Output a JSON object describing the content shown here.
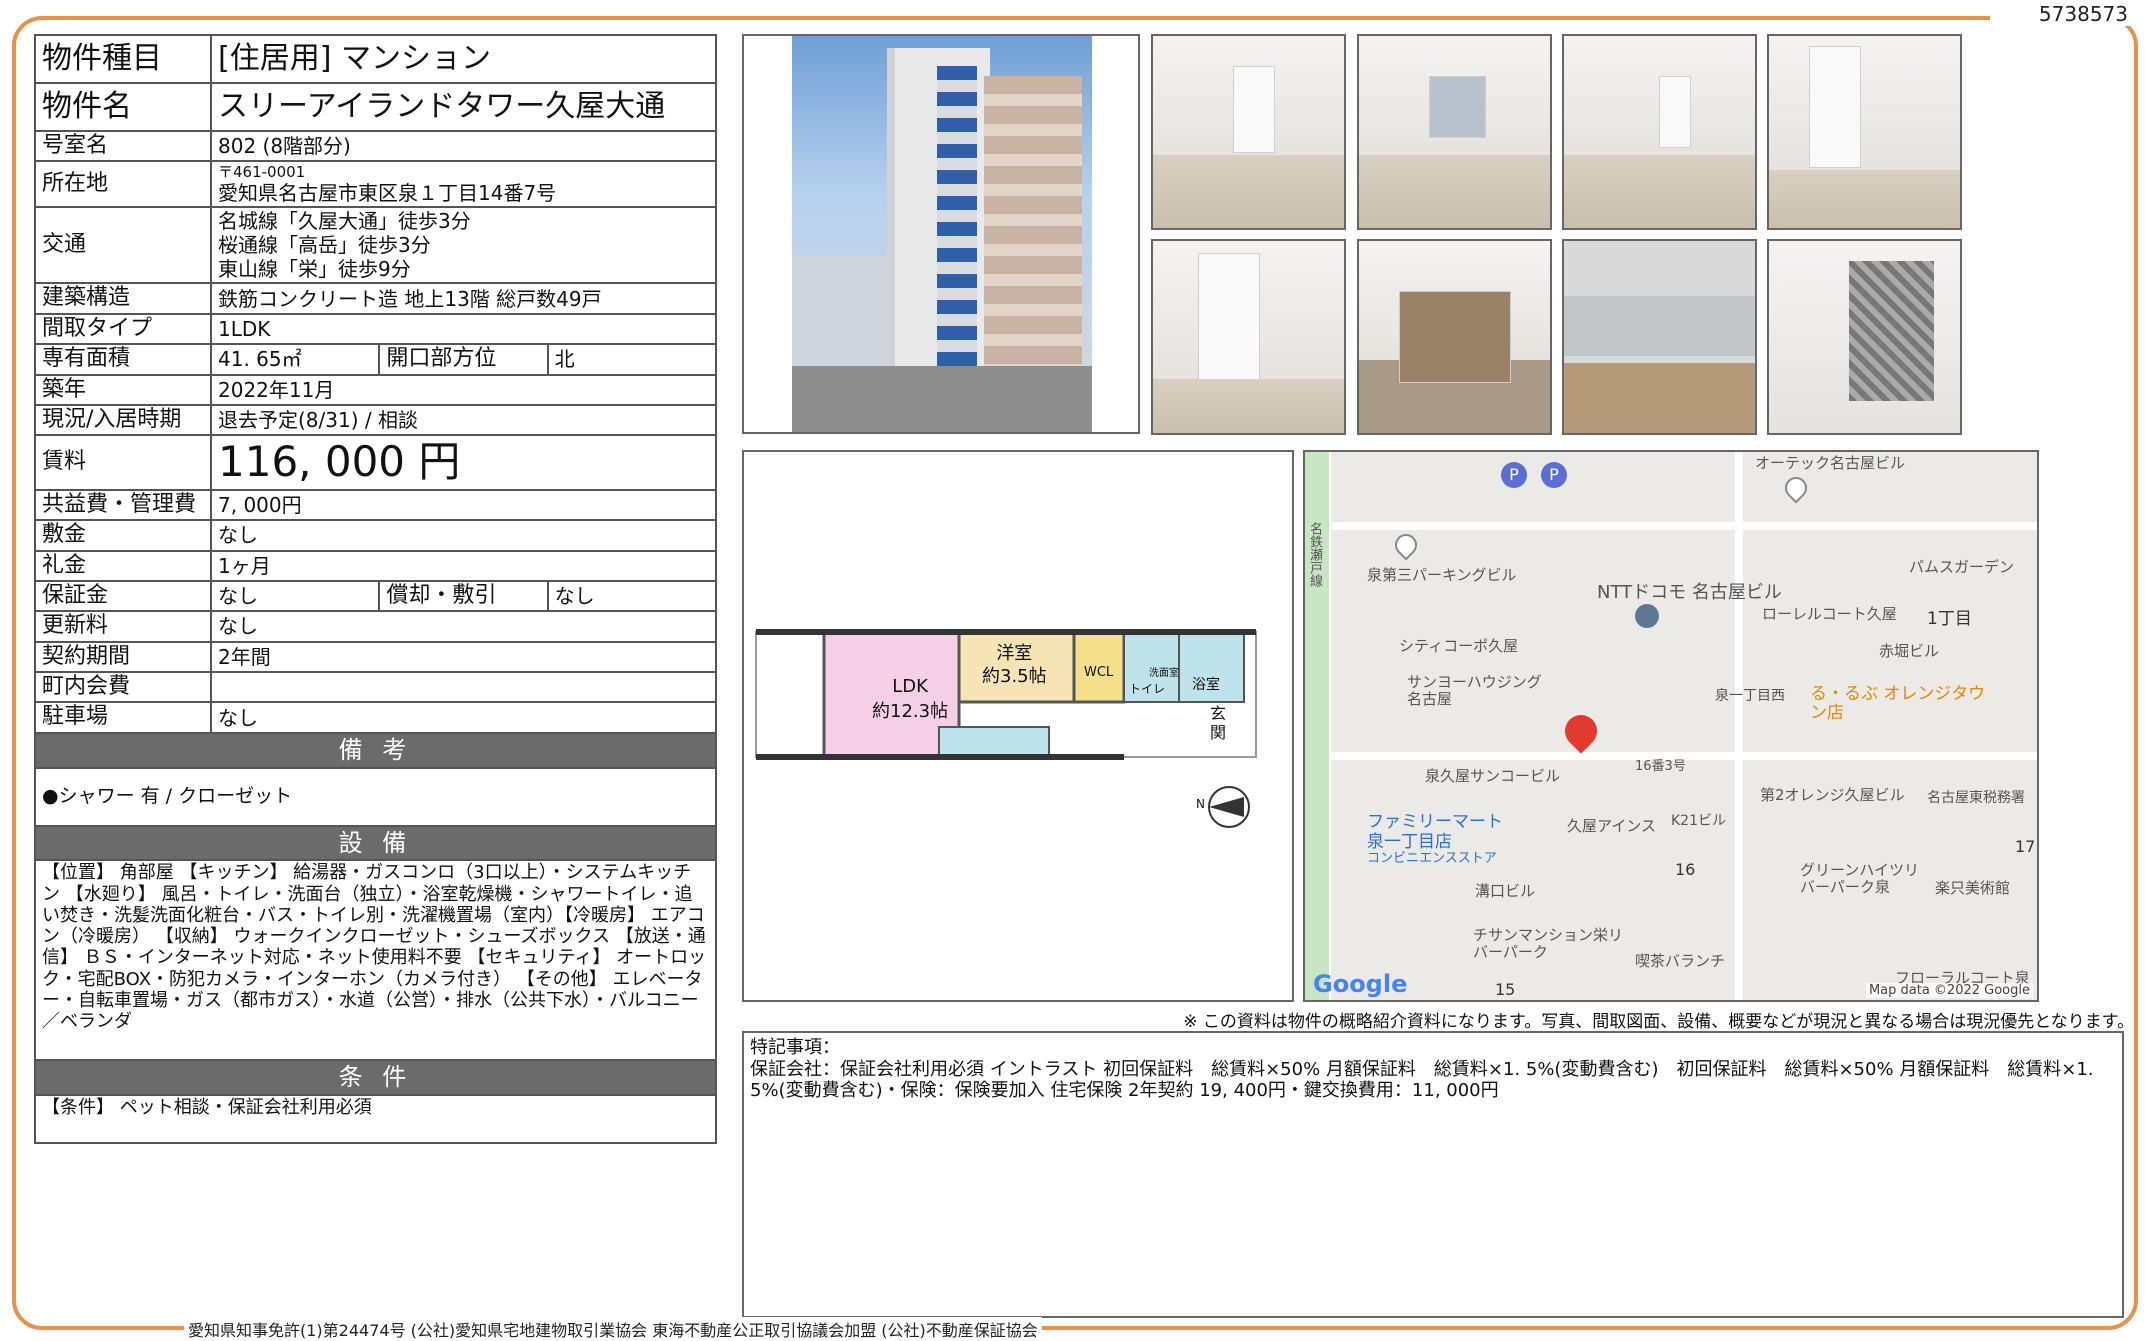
{
  "doc_id": "5738573",
  "property": {
    "rows": [
      {
        "key": "物件種目",
        "value": "[住居用] マンション"
      },
      {
        "key": "物件名",
        "value": "スリーアイランドタワー久屋大通"
      },
      {
        "key": "号室名",
        "value": "802 (8階部分)"
      },
      {
        "key": "所在地",
        "postal": "〒461-0001",
        "value": "愛知県名古屋市東区泉１丁目14番7号"
      },
      {
        "key": "交通",
        "lines": [
          "名城線「久屋大通」徒歩3分",
          "桜通線「高岳」徒歩3分",
          "東山線「栄」徒歩9分"
        ]
      },
      {
        "key": "建築構造",
        "value": "鉄筋コンクリート造 地上13階 総戸数49戸"
      },
      {
        "key": "間取タイプ",
        "value": "1LDK"
      },
      {
        "key": "専有面積",
        "value": "41. 65㎡",
        "key2": "開口部方位",
        "value2": "北"
      },
      {
        "key": "築年",
        "value": "2022年11月"
      },
      {
        "key": "現況/入居時期",
        "value": "退去予定(8/31)  /  相談"
      },
      {
        "key": "賃料",
        "value": "116, 000 円"
      },
      {
        "key": "共益費・管理費",
        "value": "7, 000円"
      },
      {
        "key": "敷金",
        "value": "なし"
      },
      {
        "key": "礼金",
        "value": "1ヶ月"
      },
      {
        "key": "保証金",
        "value": "なし",
        "key2": "償却・敷引",
        "value2": "なし"
      },
      {
        "key": "更新料",
        "value": "なし"
      },
      {
        "key": "契約期間",
        "value": "2年間"
      },
      {
        "key": "町内会費",
        "value": ""
      },
      {
        "key": "駐車場",
        "value": "なし"
      }
    ],
    "bikou_title": "備 考",
    "bikou_text": "●シャワー 有 / クローゼット",
    "setsubi_title": "設 備",
    "setsubi_text": "【位置】 角部屋 【キッチン】 給湯器・ガスコンロ（3口以上）・システムキッチン 【水廻り】 風呂・トイレ・洗面台（独立）・浴室乾燥機・シャワートイレ・追い焚き・洗髪洗面化粧台・バス・トイレ別・洗濯機置場（室内）【冷暖房】 エアコン（冷暖房） 【収納】 ウォークインクローゼット・シューズボックス 【放送・通信】 ＢＳ・インターネット対応・ネット使用料不要 【セキュリティ】 オートロック・宅配BOX・防犯カメラ・インターホン（カメラ付き） 【その他】 エレベーター・自転車置場・ガス（都市ガス）・水道（公営）・排水（公共下水）・バルコニー／ベランダ",
    "jouken_title": "条 件",
    "jouken_text": "【条件】 ペット相談・保証会社利用必須"
  },
  "floorplan": {
    "ldk": "LDK",
    "ldk_size": "約12.3帖",
    "youshitsu": "洋室",
    "youshitsu_size": "約3.5帖",
    "wcl": "WCL",
    "toilet": "トイレ",
    "senmen": "洗面室",
    "bath": "浴室",
    "genkan1": "玄",
    "genkan2": "関",
    "north": "N"
  },
  "map": {
    "labels": [
      "オーテック名古屋ビル",
      "泉第三パーキングビル",
      "NTTドコモ 名古屋ビル",
      "パムスガーデン",
      "ローレルコート久屋",
      "1丁目",
      "赤堀ビル",
      "シティコーポ久屋",
      "サンヨーハウジング名古屋",
      "泉一丁目西",
      "る・るぶ オレンジタウン店",
      "泉久屋サンコービル",
      "16番3号",
      "ファミリーマート",
      "泉一丁目店",
      "コンビニエンスストア",
      "久屋アインス",
      "K21ビル",
      "第2オレンジ久屋ビル",
      "名古屋東税務署",
      "16",
      "17",
      "溝口ビル",
      "グリーンハイツリバーパーク泉",
      "楽只美術館",
      "チサンマンション栄リバーパーク",
      "喫茶バランチ",
      "フローラルコート泉",
      "15",
      "名鉄瀬戸線"
    ],
    "logo": "Google",
    "attribution": "Map data ©2022 Google",
    "pin_color": "#e23a2e"
  },
  "notice": "※ この資料は物件の概略紹介資料になります。写真、間取図面、設備、概要などが現況と異なる場合は現況優先となります。",
  "remarks": {
    "title": "特記事項：",
    "text": "保証会社：保証会社利用必須 イントラスト 初回保証料　総賃料×50% 月額保証料　総賃料×1. 5%(変動費含む)　初回保証料　総賃料×50% 月額保証料　総賃料×1. 5%(変動費含む)・保険：保険要加入 住宅保険 2年契約 19, 400円・鍵交換費用：11, 000円"
  },
  "footer": "愛知県知事免許(1)第24474号 (公社)愛知県宅地建物取引業協会 東海不動産公正取引協議会加盟 (公社)不動産保証協会",
  "colors": {
    "frame": "#e8914a",
    "section_header": "#6b6b6b",
    "ldk": "#f4cfe6",
    "youshitsu": "#f6e4b5",
    "wcl": "#f4e08a",
    "water": "#bfe3ea"
  }
}
